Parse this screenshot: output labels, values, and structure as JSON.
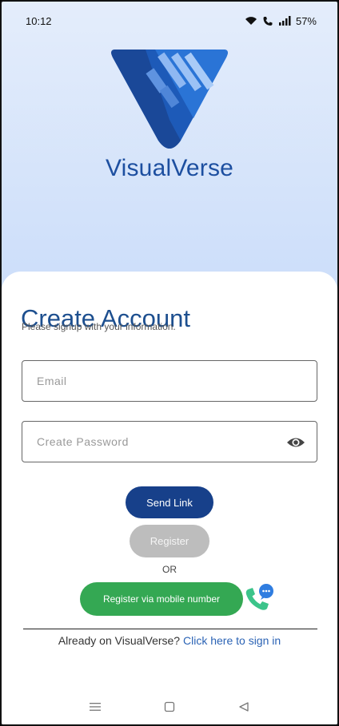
{
  "status_bar": {
    "time": "10:12",
    "battery": "57%",
    "icons": [
      "wifi-icon",
      "call-icon",
      "signal-icon"
    ]
  },
  "brand": {
    "name": "VisualVerse",
    "logo_icon": "visualverse-logo-icon",
    "color": "#1d4fa0"
  },
  "form": {
    "title": "Create Account",
    "subtitle": "Please signup with your information.",
    "email_placeholder": "Email",
    "email_value": "",
    "password_placeholder": "Create Password",
    "password_value": "",
    "password_toggle_icon": "eye-icon"
  },
  "actions": {
    "send_link_label": "Send Link",
    "register_label": "Register",
    "or_label": "OR",
    "mobile_label": "Register via mobile number",
    "chat_icon": "phone-chat-icon"
  },
  "signin": {
    "prompt": "Already on VisualVerse?",
    "link": "Click here to sign in"
  },
  "navbar": {
    "icons": [
      "menu-icon",
      "home-icon",
      "back-icon"
    ]
  },
  "colors": {
    "primary": "#17408a",
    "success": "#34a853",
    "disabled": "#bdbdbd",
    "link": "#2b63b5"
  }
}
